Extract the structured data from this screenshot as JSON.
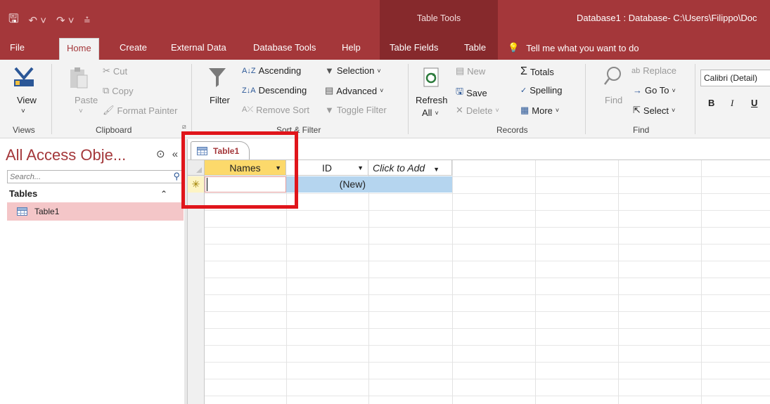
{
  "window": {
    "title": "Database1 : Database- C:\\Users\\Filippo\\Doc",
    "table_tools_label": "Table Tools"
  },
  "tabs": {
    "file": "File",
    "home": "Home",
    "create": "Create",
    "external_data": "External Data",
    "database_tools": "Database Tools",
    "help": "Help",
    "table_fields": "Table Fields",
    "table": "Table",
    "tell_me": "Tell me what you want to do"
  },
  "ribbon": {
    "views": {
      "view": "View",
      "group": "Views"
    },
    "clipboard": {
      "paste": "Paste",
      "cut": "Cut",
      "copy": "Copy",
      "format_painter": "Format Painter",
      "group": "Clipboard"
    },
    "sort_filter": {
      "filter": "Filter",
      "ascending": "Ascending",
      "descending": "Descending",
      "remove_sort": "Remove Sort",
      "selection": "Selection",
      "advanced": "Advanced",
      "toggle_filter": "Toggle Filter",
      "group": "Sort & Filter"
    },
    "records": {
      "refresh": "Refresh",
      "refresh_all": "All",
      "new": "New",
      "save": "Save",
      "delete": "Delete",
      "totals": "Totals",
      "spelling": "Spelling",
      "more": "More",
      "group": "Records"
    },
    "find": {
      "find": "Find",
      "replace": "Replace",
      "goto": "Go To",
      "select": "Select",
      "group": "Find"
    },
    "font": {
      "font_name": "Calibri (Detail)",
      "bold": "B",
      "italic": "I",
      "underline": "U"
    }
  },
  "nav_pane": {
    "title": "All Access Obje...",
    "search_placeholder": "Search...",
    "group": "Tables",
    "items": [
      {
        "label": "Table1"
      }
    ]
  },
  "document": {
    "tab_label": "Table1",
    "columns": [
      {
        "label": "Names"
      },
      {
        "label": "ID"
      },
      {
        "label": "Click to Add"
      }
    ],
    "new_row": {
      "names_value": "",
      "id_value": "(New)",
      "marker": "✳"
    }
  },
  "colors": {
    "accent": "#a4373a",
    "accent_dark": "#86292c",
    "selected_nav": "#f4c6c8",
    "header_active": "#fcd96b",
    "new_row": "#b5d5ef",
    "highlight_box": "#e0151b"
  }
}
